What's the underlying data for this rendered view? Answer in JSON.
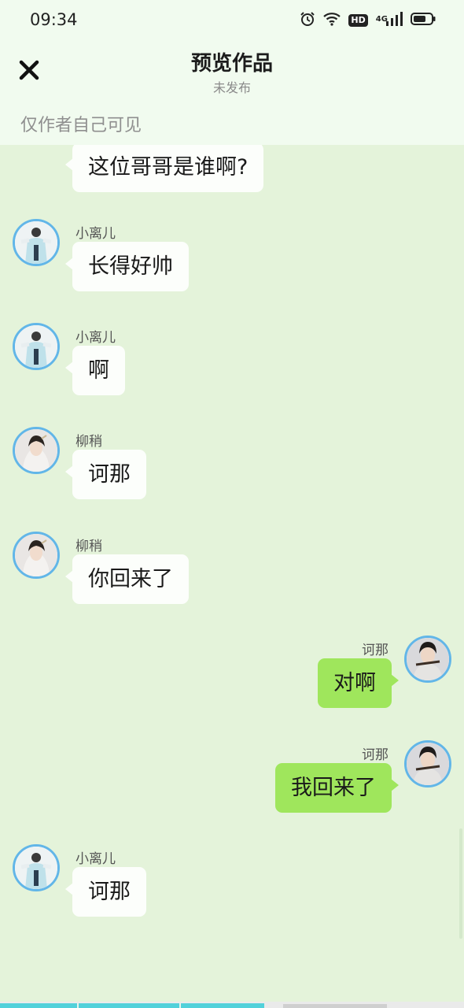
{
  "status_bar": {
    "time": "09:34",
    "hd": "HD",
    "network": "4G"
  },
  "header": {
    "title": "预览作品",
    "subtitle": "未发布",
    "visibility": "仅作者自己可见"
  },
  "messages": [
    {
      "side": "left",
      "sender": "",
      "text": "这位哥哥是谁啊?",
      "avatar": "xiaolier-avatar"
    },
    {
      "side": "left",
      "sender": "小离儿",
      "text": "长得好帅",
      "avatar": "xiaolier-avatar"
    },
    {
      "side": "left",
      "sender": "小离儿",
      "text": "啊",
      "avatar": "xiaolier-avatar"
    },
    {
      "side": "left",
      "sender": "柳稍",
      "text": "诃那",
      "avatar": "liushao-avatar"
    },
    {
      "side": "left",
      "sender": "柳稍",
      "text": "你回来了",
      "avatar": "liushao-avatar"
    },
    {
      "side": "right",
      "sender": "诃那",
      "text": "对啊",
      "avatar": "hena-avatar"
    },
    {
      "side": "right",
      "sender": "诃那",
      "text": "我回来了",
      "avatar": "hena-avatar"
    },
    {
      "side": "left",
      "sender": "小离儿",
      "text": "诃那",
      "avatar": "xiaolier-avatar"
    }
  ],
  "colors": {
    "header_bg": "#f1fbef",
    "chat_bg": "#e4f3da",
    "bubble_left": "#fcfefb",
    "bubble_right": "#9fe65c",
    "avatar_ring": "#62b6e8",
    "progress": "#52d1da"
  },
  "playback": {
    "progress": 0.57
  }
}
